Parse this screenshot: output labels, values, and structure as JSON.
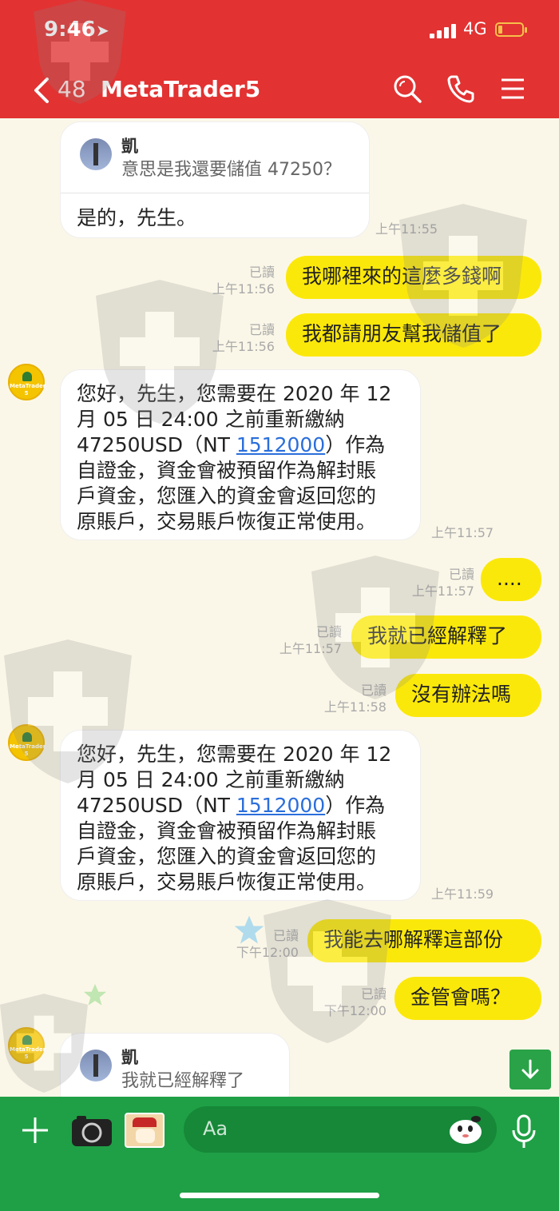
{
  "status_bar": {
    "time": "9:46",
    "network": "4G"
  },
  "header": {
    "back_count": "48",
    "title": "MetaTrader5"
  },
  "messages": [
    {
      "reply_name": "凱",
      "reply_text": "意思是我還要儲值 47250？",
      "text": "是的，先生。",
      "time": "上午11:55"
    },
    {
      "read": "已讀",
      "time": "上午11:56",
      "text": "我哪裡來的這麼多錢啊"
    },
    {
      "read": "已讀",
      "time": "上午11:56",
      "text": "我都請朋友幫我儲值了"
    },
    {
      "avatar_label": "MetaTrader 5",
      "lines": [
        "您好，先生，您需要在 2020 年 12",
        "月 05 日 24:00 之前重新繳納",
        "47250USD（NT ",
        "1512000",
        "）作為",
        "自證金，資金會被預留作為解封賬",
        "戶資金，您匯入的資金會返回您的",
        "原賬戶，交易賬戶恢復正常使用。"
      ],
      "time": "上午11:57"
    },
    {
      "read": "已讀",
      "time": "上午11:57",
      "text": "...."
    },
    {
      "read": "已讀",
      "time": "上午11:57",
      "text": "我就已經解釋了"
    },
    {
      "read": "已讀",
      "time": "上午11:58",
      "text": "沒有辦法嗎"
    },
    {
      "avatar_label": "MetaTrader 5",
      "lines": [
        "您好，先生，您需要在 2020 年 12",
        "月 05 日 24:00 之前重新繳納",
        "47250USD（NT ",
        "1512000",
        "）作為",
        "自證金，資金會被預留作為解封賬",
        "戶資金，您匯入的資金會返回您的",
        "原賬戶，交易賬戶恢復正常使用。"
      ],
      "time": "上午11:59"
    },
    {
      "read": "已讀",
      "time": "下午12:00",
      "text": "我能去哪解釋這部份"
    },
    {
      "read": "已讀",
      "time": "下午12:00",
      "text": "金管會嗎？"
    },
    {
      "avatar_label": "MetaTrader 5",
      "reply_name": "凱",
      "reply_text": "我就已經解釋了"
    }
  ],
  "input": {
    "placeholder": "Aa"
  },
  "colors": {
    "header": "#e23232",
    "bubble_out": "#fbe80b",
    "bottom_bar": "#1fa046",
    "background": "#fbf7e8"
  },
  "icons": [
    "location-arrow-icon",
    "signal-icon",
    "battery-icon",
    "back-chevron-icon",
    "search-icon",
    "phone-icon",
    "menu-icon",
    "plus-icon",
    "camera-icon",
    "sticker-thumb-icon",
    "emoji-icon",
    "microphone-icon",
    "scroll-down-icon"
  ]
}
